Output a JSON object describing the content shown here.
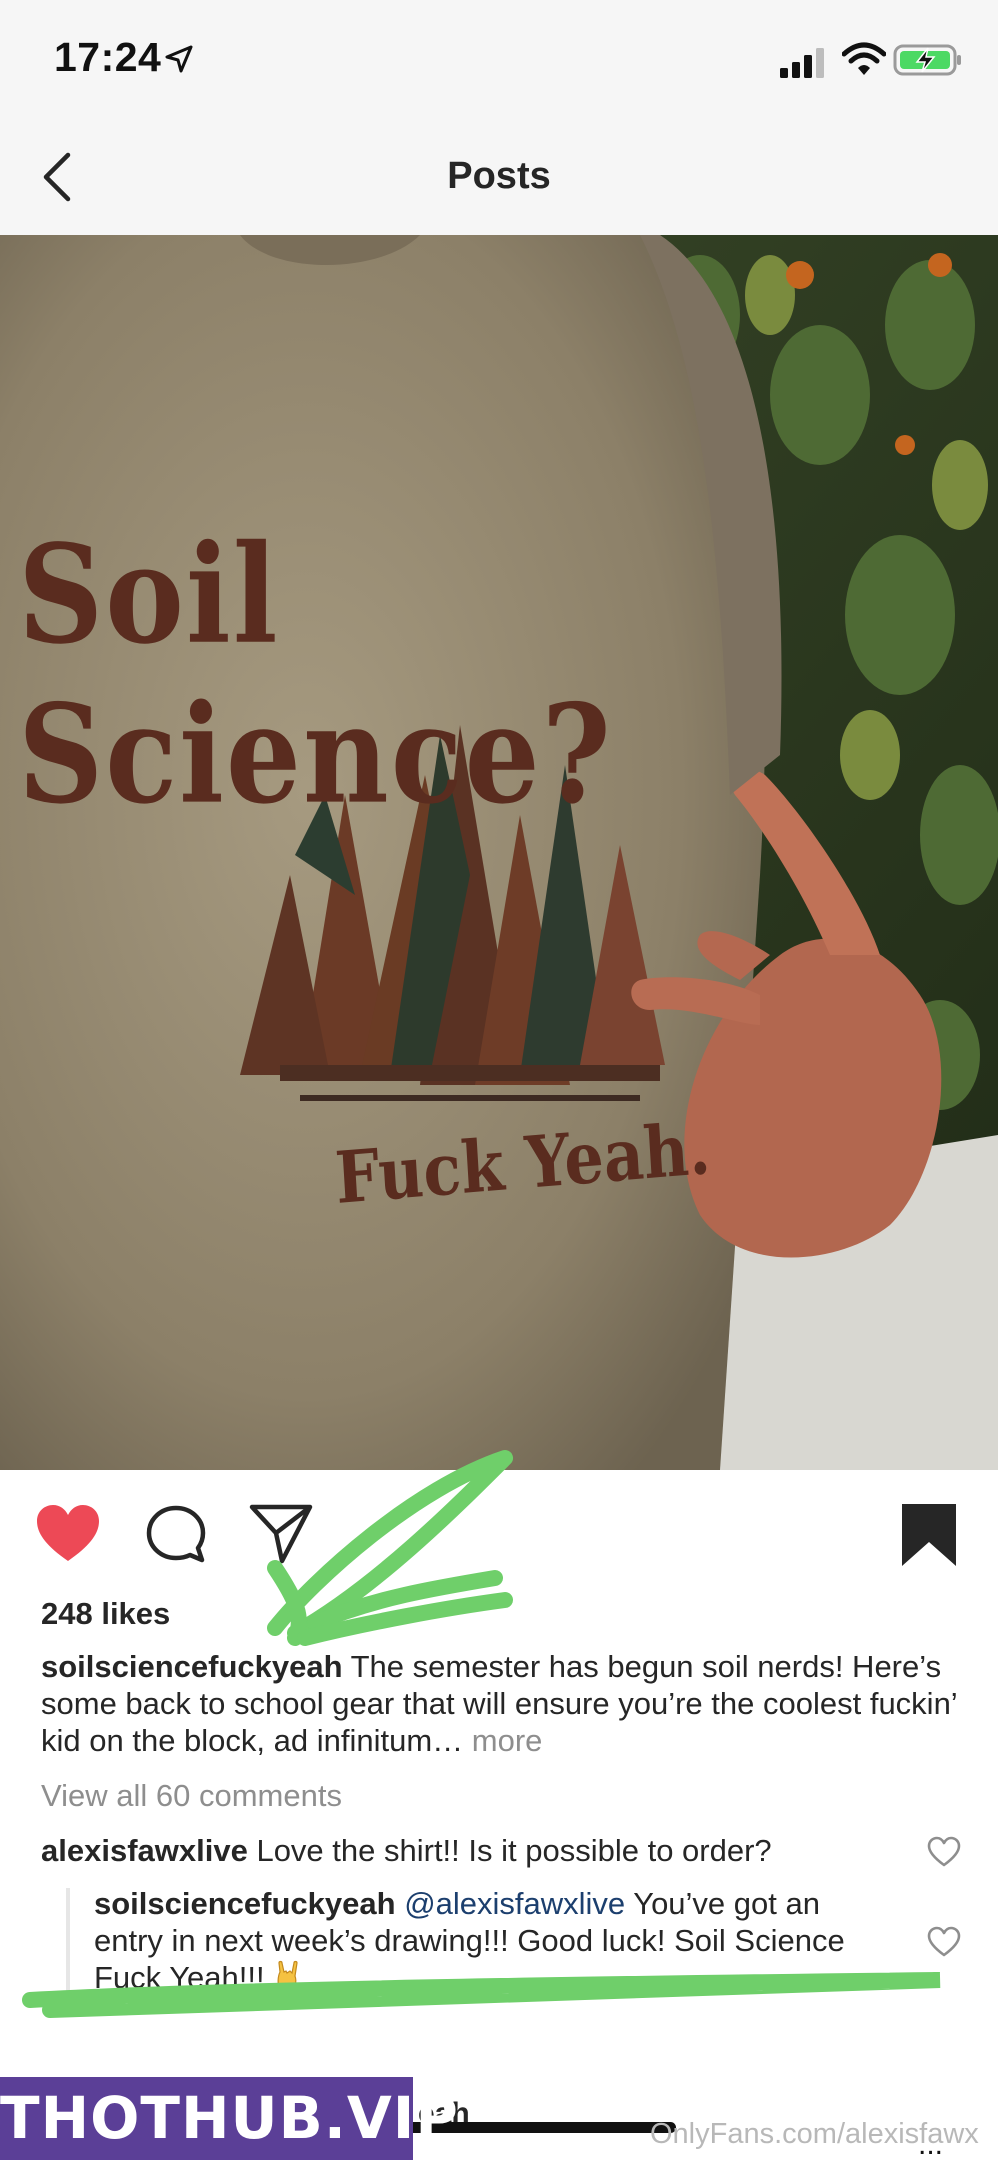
{
  "status_bar": {
    "time": "17:24",
    "icons": [
      "location-arrow-icon",
      "signal-icon",
      "wifi-icon",
      "battery-charging-icon"
    ],
    "battery_color": "#4cd964"
  },
  "nav": {
    "title": "Posts",
    "back_icon": "chevron-left-icon"
  },
  "post": {
    "image": {
      "shirt_text_top": "Soil Science?",
      "shirt_text_bottom": "Fuck Yeah."
    },
    "actions": {
      "icons": [
        "heart-filled-icon",
        "comment-icon",
        "share-icon",
        "bookmark-filled-icon"
      ],
      "liked": true,
      "like_color": "#ed4956"
    },
    "likes": "248 likes",
    "caption": {
      "username": "soilsciencefuckyeah",
      "text": "The semester has begun soil nerds! Here’s some back to school gear that will ensure you’re the coolest fuckin’ kid on the block, ad infinitum…",
      "more": "more"
    },
    "view_all_comments": "View all 60 comments",
    "comments": [
      {
        "username": "alexisfawxlive",
        "text": "Love the shirt!! Is it possible to order?",
        "heart_icon": "heart-outline-icon"
      }
    ],
    "reply": {
      "username": "soilsciencefuckyeah",
      "mention": "@alexisfawxlive",
      "text": "You’ve got an entry in next week’s drawing!!! Good luck! Soil Science Fuck Yeah!!!",
      "emoji": "rock-on-hand-icon",
      "heart_icon": "heart-outline-icon"
    },
    "annotation_color": "#6fcf6a"
  },
  "footer": {
    "partial_text": "eah",
    "watermark_logo": "THOTHUB.VIP",
    "watermark_text": "OnlyFans.com/alexisfawx",
    "more_dots": "..."
  }
}
